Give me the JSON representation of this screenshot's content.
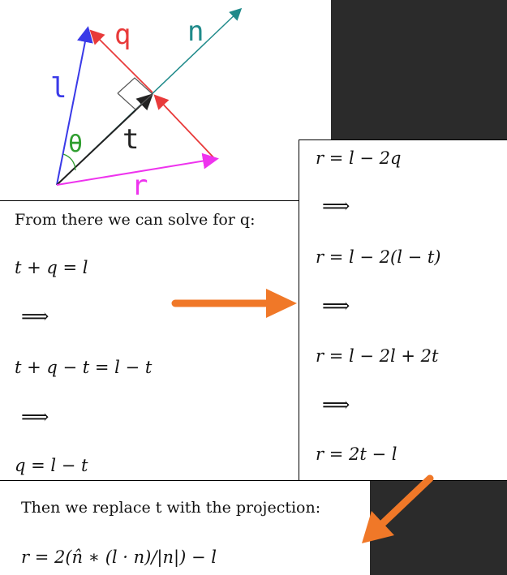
{
  "diagram": {
    "labels": {
      "q": "q",
      "n": "n",
      "l": "l",
      "theta": "θ",
      "t": "t",
      "r": "r"
    },
    "colors": {
      "l": "#3a3ae8",
      "q": "#e83a3a",
      "n": "#1f8a8a",
      "t": "#222222",
      "r": "#ee33ee",
      "theta": "#2f9e2f",
      "arrow": "#f07828"
    }
  },
  "left_panel": {
    "intro": "From there we can solve for q:",
    "lines": [
      "t + q = l",
      "⟹",
      "t + q − t = l − t",
      "⟹",
      "q = l − t"
    ]
  },
  "right_panel": {
    "lines": [
      "r = l − 2q",
      "⟹",
      "r = l − 2(l − t)",
      "⟹",
      "r = l − 2l + 2t",
      "⟹",
      "r = 2t − l"
    ]
  },
  "bottom_panel": {
    "intro": "Then we replace t with the projection:",
    "formula": "r = 2(n̂ ∗ (l · n)/|n|) − l"
  }
}
